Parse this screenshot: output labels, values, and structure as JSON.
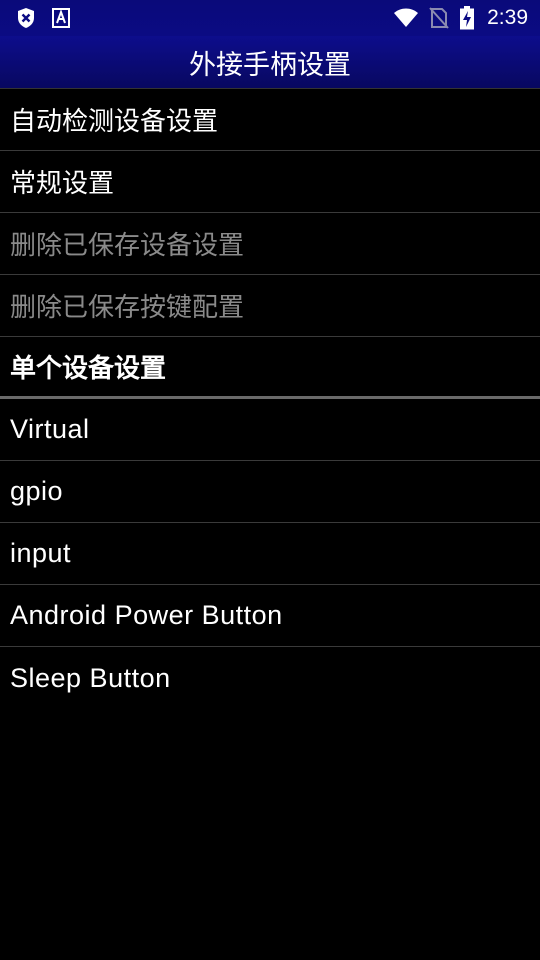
{
  "status_bar": {
    "time": "2:39",
    "left_icons": [
      "shield-x-icon",
      "accessibility-a-icon"
    ],
    "right_icons": [
      "wifi-icon",
      "no-sim-icon",
      "battery-charging-icon"
    ]
  },
  "title_bar": {
    "title": "外接手柄设置"
  },
  "menu_items": [
    {
      "label": "自动检测设备设置",
      "enabled": true
    },
    {
      "label": "常规设置",
      "enabled": true
    },
    {
      "label": "删除已保存设备设置",
      "enabled": false
    },
    {
      "label": "删除已保存按键配置",
      "enabled": false
    }
  ],
  "section_header": "单个设备设置",
  "devices": [
    {
      "label": "Virtual"
    },
    {
      "label": "gpio"
    },
    {
      "label": "input"
    },
    {
      "label": "Android Power Button"
    },
    {
      "label": "Sleep Button"
    }
  ],
  "colors": {
    "background": "#000000",
    "titlebar": "#0b0b83",
    "text": "#ffffff",
    "disabled_text": "#8a8a8a",
    "divider": "#3a3a3a"
  }
}
